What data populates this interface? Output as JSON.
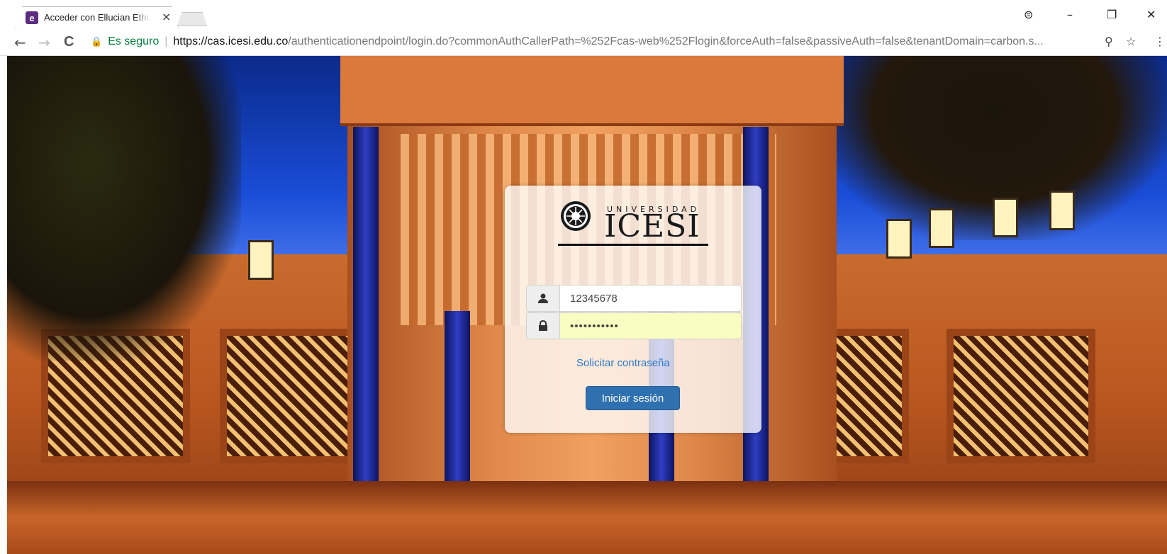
{
  "browser": {
    "tab_title": "Acceder con Ellucian Ethos",
    "favicon_letter": "e",
    "omnibox": {
      "secure_label": "Es seguro",
      "url_host": "https://cas.icesi.edu.co",
      "url_path": "/authenticationendpoint/login.do?commonAuthCallerPath=%252Fcas-web%252Flogin&forceAuth=false&passiveAuth=false&tenantDomain=carbon.s..."
    },
    "icons": {
      "back": "←",
      "forward": "→",
      "reload": "C",
      "lock": "🔒",
      "profile": "⊜",
      "minimize": "–",
      "restore": "❐",
      "close": "✕",
      "extension": "⚲",
      "star": "☆",
      "menu": "⋮",
      "tab_close": "×"
    }
  },
  "login": {
    "logo_top": "UNIVERSIDAD",
    "logo_name": "ICESI",
    "username_value": "12345678",
    "password_mask": "•••••••••••",
    "forgot_label": "Solicitar contraseña",
    "submit_label": "Iniciar sesión",
    "user_icon": "👤",
    "lock_icon": "🔒"
  },
  "colors": {
    "accent": "#2f71b0",
    "secure": "#0b8043",
    "link": "#2a78c6"
  }
}
